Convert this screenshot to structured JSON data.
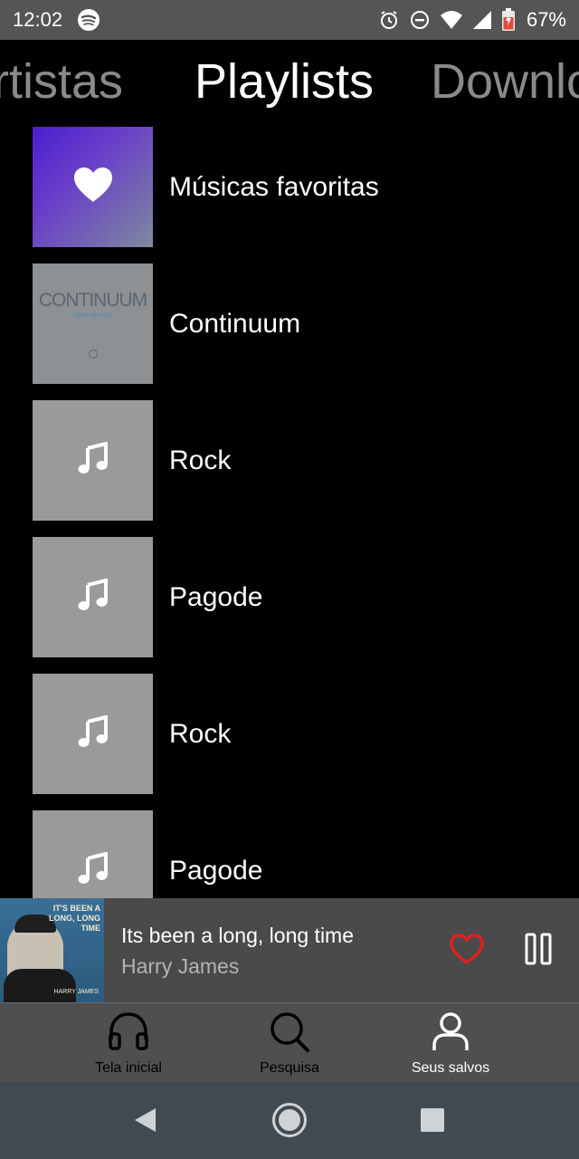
{
  "status_bar": {
    "time": "12:02",
    "battery": "67%"
  },
  "tabs": {
    "prev": "Artistas",
    "active": "Playlists",
    "next": "Downloads"
  },
  "playlists": [
    {
      "name": "Músicas favoritas",
      "cover": "heart-icon"
    },
    {
      "name": "Continuum",
      "cover": "album-art"
    },
    {
      "name": "Rock",
      "cover": "music-note-icon"
    },
    {
      "name": "Pagode",
      "cover": "music-note-icon"
    },
    {
      "name": "Rock",
      "cover": "music-note-icon"
    },
    {
      "name": "Pagode",
      "cover": "music-note-icon"
    }
  ],
  "album_cover": {
    "title": "CONTINUUM",
    "subtitle": "JOHN MAYER"
  },
  "now_playing": {
    "title": "Its been a long, long time",
    "artist": "Harry James",
    "art_text": "IT'S BEEN A LONG, LONG TIME",
    "art_name": "HARRY JAMES"
  },
  "bottom_nav": {
    "items": [
      {
        "label": "Tela inicial",
        "icon": "headphones-icon"
      },
      {
        "label": "Pesquisa",
        "icon": "search-icon"
      },
      {
        "label": "Seus salvos",
        "icon": "user-icon"
      }
    ]
  },
  "colors": {
    "accent_heart": "#e02020",
    "background": "#000000",
    "bar": "#4a4a4a"
  }
}
